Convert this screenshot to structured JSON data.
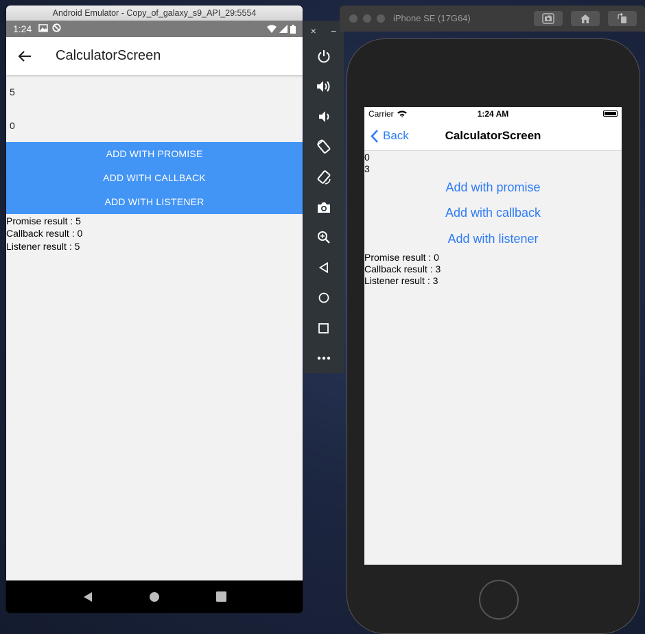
{
  "android": {
    "window_title": "Android Emulator - Copy_of_galaxy_s9_API_29:5554",
    "status_time": "1:24",
    "screen_title": "CalculatorScreen",
    "first_value": "5",
    "second_value": "0",
    "buttons": {
      "promise": "ADD WITH PROMISE",
      "callback": "ADD WITH CALLBACK",
      "listener": "ADD WITH LISTENER"
    },
    "results": {
      "promise": "Promise result : 5",
      "callback": "Callback result : 0",
      "listener": "Listener result : 5"
    },
    "button_color": "#4294f5"
  },
  "tool_panel": {
    "close": "×",
    "minimize": "−",
    "tools": [
      "power-icon",
      "volume-up-icon",
      "volume-down-icon",
      "rotate-left-icon",
      "rotate-right-icon",
      "camera-icon",
      "zoom-icon",
      "back-icon",
      "home-icon",
      "overview-icon",
      "more-icon"
    ]
  },
  "ios": {
    "window_title": "iPhone SE (17G64)",
    "carrier": "Carrier",
    "status_time": "1:24 AM",
    "back_label": "Back",
    "screen_title": "CalculatorScreen",
    "first_value": "0",
    "second_value": "3",
    "buttons": {
      "promise": "Add with promise",
      "callback": "Add with callback",
      "listener": "Add with listener"
    },
    "results": {
      "promise": "Promise result : 0",
      "callback": "Callback result : 3",
      "listener": "Listener result : 3"
    },
    "tint_color": "#2f7cf6"
  }
}
